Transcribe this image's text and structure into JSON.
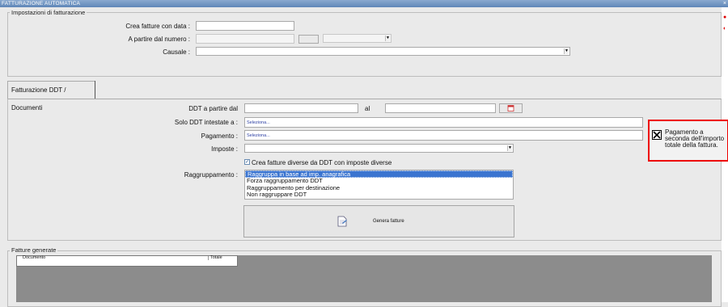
{
  "window": {
    "title": "FATTURAZIONE AUTOMATICA",
    "close_glyph": "×"
  },
  "impostazioni": {
    "legend": "Impostazioni di fatturazione",
    "crea_label": "Crea fatture con data :",
    "crea_value": "",
    "partire_label": "A partire dal numero :",
    "partire_value": "",
    "causale_label": "Causale :",
    "causale_value": ""
  },
  "tab": {
    "label": "Fatturazione DDT / Documenti"
  },
  "ddt": {
    "from_label": "DDT a partire dal",
    "from_value": "",
    "al_label": "al",
    "to_value": "",
    "intestate_label": "Solo DDT intestate a :",
    "intestate_value": "Seleziona...",
    "pagamento_label": "Pagamento :",
    "pagamento_value": "Seleziona...",
    "imposte_label": "Imposte :",
    "imposte_value": "",
    "crea_diverse_label": "Crea fatture diverse da DDT con imposte diverse",
    "crea_diverse_checked": true,
    "raggruppamento_label": "Raggruppamento :",
    "raggruppamento_options": [
      "Raggruppa in base ad imp. anagrafica",
      "Forza raggruppamento DDT",
      "Raggruppamento per destinazione",
      "Non raggruppare DDT"
    ],
    "raggruppamento_selected": "Raggruppa in base ad imp. anagrafica",
    "genera_label": "Genera fatture"
  },
  "alert": {
    "text_line1": "Pagamento a",
    "text_line2": "seconda dell'importo",
    "text_line3": "totale della fattura.",
    "checked": true,
    "border_color": "#e00000"
  },
  "fatture": {
    "legend": "Fatture generate",
    "columns": [
      "Documento",
      "Totale"
    ]
  }
}
